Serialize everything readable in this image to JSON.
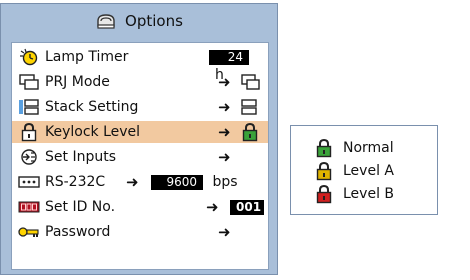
{
  "window": {
    "title": "Options"
  },
  "menu": {
    "items": [
      {
        "label": "Lamp Timer",
        "value": "24",
        "unit": "h",
        "icon": "clock-icon"
      },
      {
        "label": "PRJ Mode",
        "icon": "projector-icon"
      },
      {
        "label": "Stack Setting",
        "icon": "stack-icon"
      },
      {
        "label": "Keylock Level",
        "icon": "lock-icon",
        "selected": true
      },
      {
        "label": "Set Inputs",
        "icon": "inputs-icon"
      },
      {
        "label": "RS-232C",
        "value": "9600",
        "unit": "bps",
        "icon": "serial-port-icon"
      },
      {
        "label": "Set ID No.",
        "value": "001",
        "icon": "id-number-icon"
      },
      {
        "label": "Password",
        "icon": "key-icon"
      }
    ]
  },
  "submenu": {
    "items": [
      {
        "label": "Normal",
        "icon": "lock-green-icon",
        "color": "#3aa33a"
      },
      {
        "label": "Level A",
        "icon": "lock-yellow-icon",
        "color": "#e0b400"
      },
      {
        "label": "Level B",
        "icon": "lock-red-icon",
        "color": "#d02020"
      }
    ]
  },
  "colors": {
    "panel": "#a9bfd9",
    "selected_row": "#f2c9a0"
  }
}
